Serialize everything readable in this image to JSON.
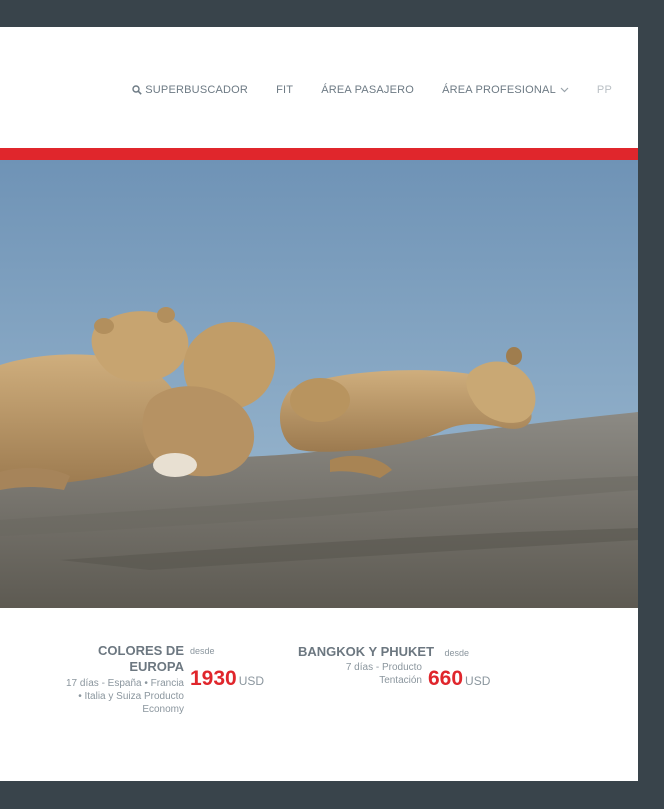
{
  "nav": {
    "search_label": "SUPERBUSCADOR",
    "fit_label": "FIT",
    "pasajero_label": "ÁREA PASAJERO",
    "profesional_label": "ÁREA PROFESIONAL",
    "lang_label": "PP"
  },
  "colors": {
    "accent": "#e0262c",
    "frame": "#39444b"
  },
  "hero": {
    "image_alt": "lion cubs resting on a rock"
  },
  "cards": [
    {
      "title_line1": "COLORES DE",
      "title_line2": "EUROPA",
      "desde": "desde",
      "meta_line1": "17 días - España • Francia",
      "meta_line2": "• Italia y Suiza Producto",
      "meta_line3": "Economy",
      "price": "1930",
      "currency": "USD"
    },
    {
      "title": "BANGKOK Y PHUKET",
      "desde": "desde",
      "meta_line1": "7 días - Producto",
      "meta_line2": "Tentación",
      "price": "660",
      "currency": "USD"
    }
  ]
}
